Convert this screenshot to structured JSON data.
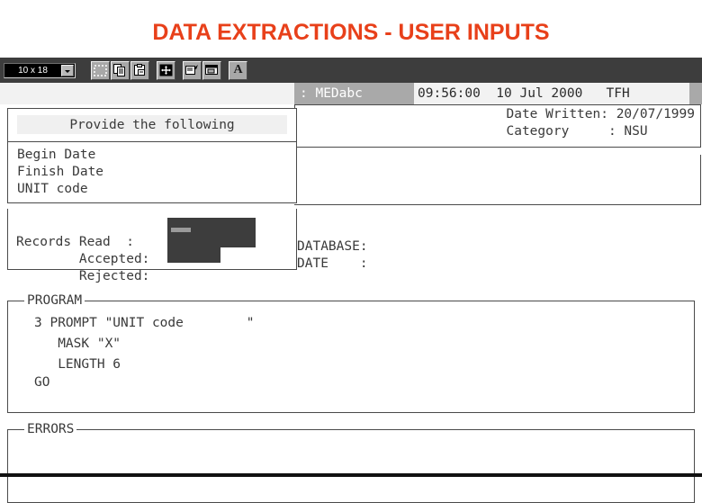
{
  "slide": {
    "title": "DATA EXTRACTIONS - USER INPUTS",
    "title_color": "#E8401A"
  },
  "toolbar": {
    "font_size_value": "10 x 18",
    "buttons": [
      {
        "name": "mark-button",
        "label": "Mark"
      },
      {
        "name": "copy-button",
        "label": "Copy"
      },
      {
        "name": "paste-button",
        "label": "Paste"
      },
      {
        "name": "fullscreen-button",
        "label": "Full Screen"
      },
      {
        "name": "properties-button",
        "label": "Properties"
      },
      {
        "name": "background-button",
        "label": "Background"
      },
      {
        "name": "font-button",
        "label": "A"
      }
    ]
  },
  "terminal": {
    "status": {
      "host": ": MEDabc",
      "clock": "09:56:00  10 Jul 2000   TFH"
    },
    "header_panel": {
      "date_written_label": "Date Written:",
      "date_written_value": "20/07/1999",
      "category_label": "Category",
      "category_sep": ":",
      "category_value": "NSU",
      "text_block": "Date Written: 20/07/1999\nCategory     : NSU"
    },
    "database_panel": {
      "database_label": "DATABASE:",
      "date_label": "DATE     :",
      "text_block": "DATABASE:\nDATE    :"
    },
    "dialog": {
      "title": "Provide the following",
      "fields": [
        {
          "label": "Begin Date",
          "value": ""
        },
        {
          "label": "Finish Date",
          "value": ""
        },
        {
          "label": "UNIT code",
          "value": ""
        }
      ],
      "labels_block": "Begin Date\nFinish Date\nUNIT code"
    },
    "records_panel": {
      "rows": [
        {
          "label": "Records Read",
          "sep": ":",
          "value": ""
        },
        {
          "label": "Accepted",
          "sep": ":",
          "value": ""
        },
        {
          "label": "Rejected",
          "sep": ":",
          "value": ""
        }
      ],
      "text_block": "Records Read  :\n        Accepted:\n        Rejected:"
    },
    "program_panel": {
      "legend": "PROGRAM",
      "code_block": "3 PROMPT \"UNIT code        \"\n   MASK \"X\"\n   LENGTH 6",
      "go_label": "GO"
    },
    "errors_panel": {
      "legend": "ERRORS",
      "content": ""
    }
  }
}
